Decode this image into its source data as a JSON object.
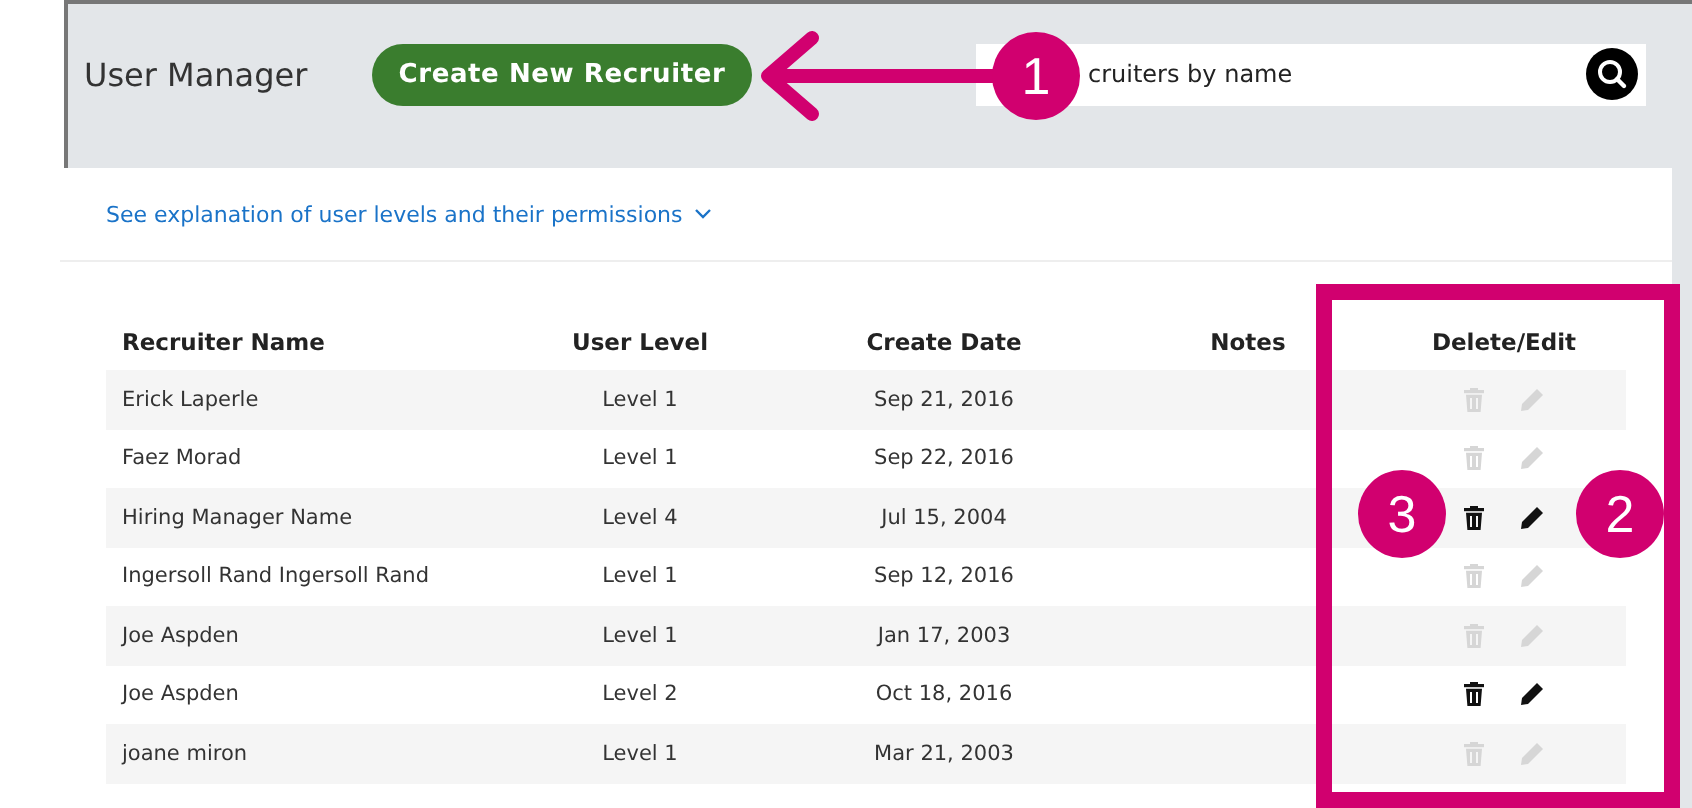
{
  "header": {
    "title": "User Manager",
    "create_button": "Create New Recruiter",
    "search": {
      "placeholder": "cruiters by name"
    }
  },
  "permissions_link": "See explanation of user levels and their permissions",
  "table": {
    "columns": [
      "Recruiter Name",
      "User Level",
      "Create Date",
      "Notes",
      "Delete/Edit"
    ],
    "rows": [
      {
        "name": "Erick Laperle",
        "level": "Level 1",
        "date": "Sep 21, 2016",
        "enabled": false
      },
      {
        "name": "Faez Morad",
        "level": "Level 1",
        "date": "Sep 22, 2016",
        "enabled": false
      },
      {
        "name": "Hiring Manager Name",
        "level": "Level 4",
        "date": "Jul 15, 2004",
        "enabled": true
      },
      {
        "name": "Ingersoll Rand Ingersoll Rand",
        "level": "Level 1",
        "date": "Sep 12, 2016",
        "enabled": false
      },
      {
        "name": "Joe Aspden",
        "level": "Level 1",
        "date": "Jan 17, 2003",
        "enabled": false
      },
      {
        "name": "Joe Aspden",
        "level": "Level 2",
        "date": "Oct 18, 2016",
        "enabled": true
      },
      {
        "name": "joane miron",
        "level": "Level 1",
        "date": "Mar 21, 2003",
        "enabled": false
      }
    ]
  },
  "callouts": [
    "1",
    "2",
    "3"
  ]
}
